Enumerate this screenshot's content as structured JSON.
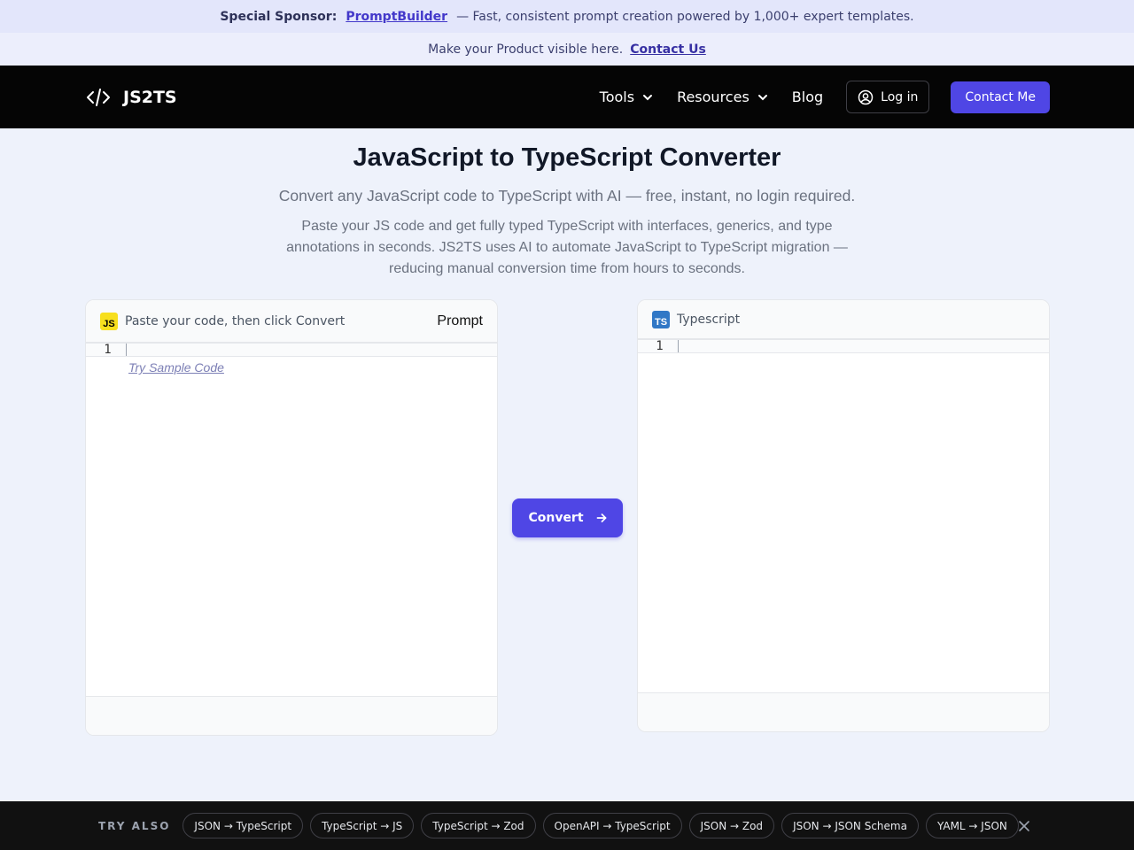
{
  "sponsor": {
    "label": "Special Sponsor:",
    "link": "PromptBuilder",
    "text": "— Fast, consistent prompt creation powered by 1,000+ expert templates."
  },
  "promo": {
    "text": "Make your Product visible here.",
    "link": "Contact Us"
  },
  "nav": {
    "brand": "JS2TS",
    "items": [
      "Tools",
      "Resources",
      "Blog"
    ],
    "login": "Log in",
    "contact": "Contact Me"
  },
  "hero": {
    "title": "JavaScript to TypeScript Converter",
    "subtitle": "Convert any JavaScript code to TypeScript with AI — free, instant, no login required.",
    "description": "Paste your JS code and get fully typed TypeScript with interfaces, generics, and type annotations in seconds. JS2TS uses AI to automate JavaScript to TypeScript migration — reducing manual conversion time from hours to seconds."
  },
  "input_panel": {
    "badge": "JS",
    "hint": "Paste your code, then click Convert",
    "prompt_label": "Prompt",
    "line_number": "1",
    "sample_link": "Try Sample Code"
  },
  "output_panel": {
    "badge": "TS",
    "title": "Typescript",
    "line_number": "1"
  },
  "convert_button": "Convert",
  "try_also": {
    "label": "TRY ALSO",
    "chips": [
      "JSON → TypeScript",
      "TypeScript → JS",
      "TypeScript → Zod",
      "OpenAPI → TypeScript",
      "JSON → Zod",
      "JSON → JSON Schema",
      "YAML → JSON"
    ]
  },
  "colors": {
    "accent": "#4f46e5",
    "nav_bg": "#050505",
    "page_bg": "#eef2fb",
    "js_badge": "#f7df1e",
    "ts_badge": "#3178c6"
  }
}
